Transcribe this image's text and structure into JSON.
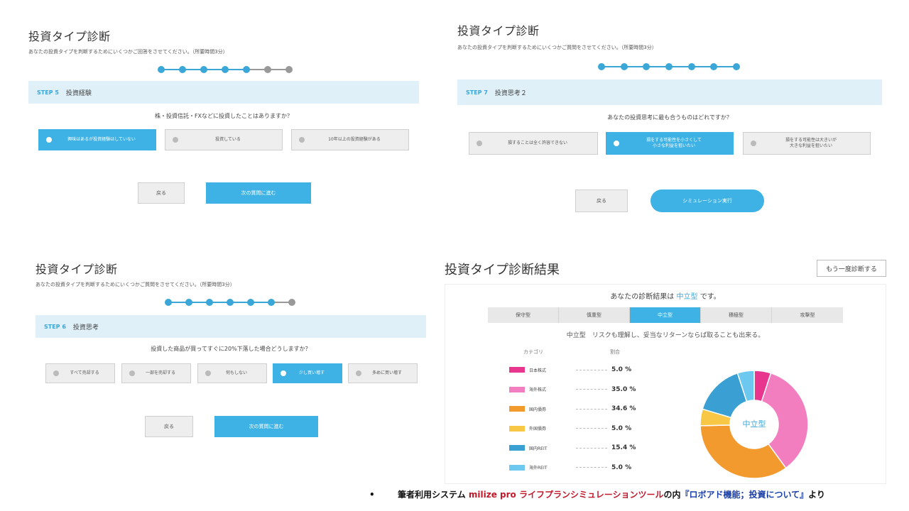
{
  "panel1": {
    "title": "投資タイプ診断",
    "desc": "あなたの投資タイプを判断するためにいくつかご回答をさせてください。（所要時間3分）",
    "step_no": "STEP 5",
    "step_title": "投資経験",
    "question": "株・投資信託・FXなどに投資したことはありますか？",
    "options": [
      "興味はあるが投資経験はしていない",
      "投資している",
      "10年以上の投資経験がある"
    ],
    "selected": 0,
    "back_label": "戻る",
    "next_label": "次の質問に進む",
    "progress_done": 5,
    "progress_total": 7
  },
  "panel2": {
    "title": "投資タイプ診断",
    "desc": "あなたの投資タイプを判断するためにいくつかご質問をさせてください。（所要時間3分）",
    "step_no": "STEP 7",
    "step_title": "投資思考２",
    "question": "あなたの投資思考に最も合うものはどれですか？",
    "options": [
      "損することは全く許容できない",
      "損をする可能性を小さくして\n小さな利益を狙いたい",
      "損をする可能性は大きいが\n大きな利益を狙いたい"
    ],
    "selected": 1,
    "back_label": "戻る",
    "next_label": "シミュレーション実行",
    "progress_done": 7,
    "progress_total": 7
  },
  "panel3": {
    "title": "投資タイプ診断",
    "desc": "あなたの投資タイプを判断するためにいくつかご質問をさせてください。（所要時間3分）",
    "step_no": "STEP 6",
    "step_title": "投資思考",
    "question": "投資した商品が買ってすぐに20%下落した場合どうしますか？",
    "options": [
      "すべて売却する",
      "一部を売却する",
      "何もしない",
      "少し買い増す",
      "多めに買い増す"
    ],
    "selected": 3,
    "back_label": "戻る",
    "next_label": "次の質問に進む",
    "progress_done": 6,
    "progress_total": 7
  },
  "result": {
    "title": "投資タイプ診断結果",
    "again_label": "もう一度診断する",
    "result_prefix": "あなたの診断結果は",
    "result_type": "中立型",
    "result_suffix": "です。",
    "tabs": [
      "保守型",
      "慎重型",
      "中立型",
      "積極型",
      "攻撃型"
    ],
    "selected_tab": 2,
    "description": "中立型　リスクも理解し、妥当なリターンならば取ることも出来る。",
    "col_category": "カテゴリ",
    "col_ratio": "割合",
    "center_label": "中立型"
  },
  "chart_data": {
    "type": "pie",
    "title": "",
    "categories": [
      "日本株式",
      "海外株式",
      "国内債券",
      "外国債券",
      "国内REIT",
      "海外REIT"
    ],
    "values": [
      5.0,
      35.0,
      34.6,
      5.0,
      15.4,
      5.0
    ],
    "value_labels": [
      "5.0 %",
      "35.0 %",
      "34.6 %",
      "5.0 %",
      "15.4 %",
      "5.0 %"
    ],
    "colors": [
      "#e8368f",
      "#f27ec0",
      "#f39a2f",
      "#f7c745",
      "#3aa0d4",
      "#6cc8ef"
    ],
    "donut": true
  },
  "footnote": {
    "bullet": "•",
    "prefix": "筆者利用システム",
    "system": "milize pro ライフプランシミュレーションツール",
    "mid": "の内",
    "feature": "『ロボアド機能；投資について』",
    "suffix": "より"
  }
}
